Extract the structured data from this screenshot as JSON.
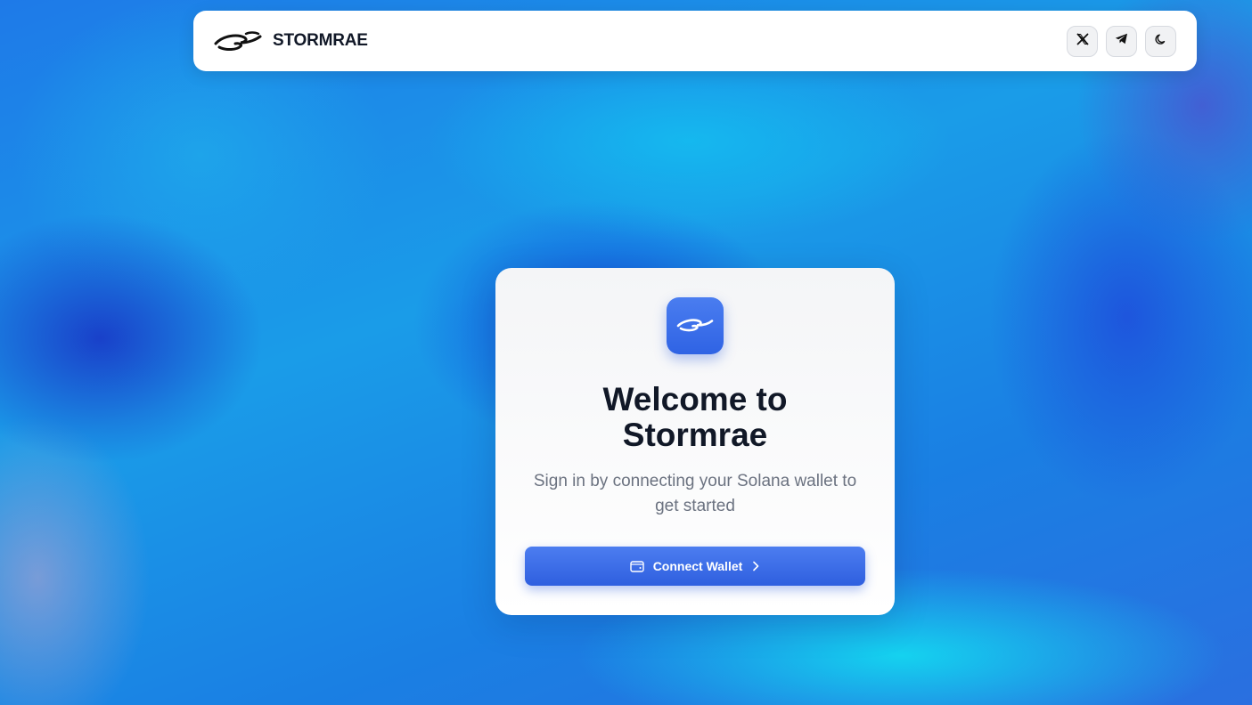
{
  "header": {
    "brand_name": "STORMRAE",
    "logo_icon": "stormrae-swirl-logo",
    "actions": [
      {
        "icon": "x-twitter-icon"
      },
      {
        "icon": "telegram-icon"
      },
      {
        "icon": "moon-icon"
      }
    ]
  },
  "card": {
    "logo_icon": "stormrae-swirl-logo",
    "title": "Welcome to Stormrae",
    "subtitle": "Sign in by connecting your Solana wallet to get started",
    "connect_button": {
      "label": "Connect Wallet",
      "leading_icon": "wallet-icon",
      "trailing_icon": "chevron-right-icon"
    }
  },
  "colors": {
    "accent": "#3b6fe8",
    "title": "#111827",
    "subtitle": "#6b7280",
    "background_primary": "#1a8fe6"
  }
}
